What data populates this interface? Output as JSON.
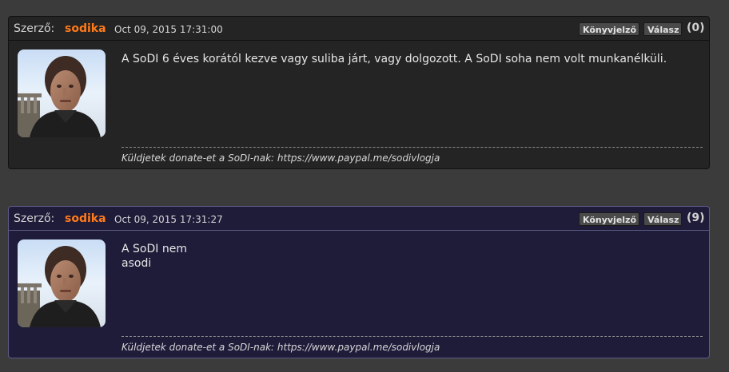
{
  "posts": [
    {
      "author_label": "Szerző:",
      "author_name": "sodika",
      "date": "Oct 09, 2015 17:31:00",
      "bookmark_label": "Könyvjelző",
      "reply_label": "Válasz",
      "reply_count": "(0)",
      "message": "A SoDI 6 éves korától kezve vagy suliba járt, vagy dolgozott. A SoDI soha nem volt munkanélküli.",
      "signature": "Küldjetek donate-et a SoDI-nak: https://www.paypal.me/sodivlogja"
    },
    {
      "author_label": "Szerző:",
      "author_name": "sodika",
      "date": "Oct 09, 2015 17:31:27",
      "bookmark_label": "Könyvjelző",
      "reply_label": "Válasz",
      "reply_count": "(9)",
      "message": "A SoDI nem\nasodi",
      "signature": "Küldjetek donate-et a SoDI-nak: https://www.paypal.me/sodivlogja"
    }
  ],
  "colors": {
    "page_background": "#3b3b3b",
    "post_background_default": "#242424",
    "post_background_highlight": "#1f1c3a",
    "author_color": "#ff7a1a"
  }
}
